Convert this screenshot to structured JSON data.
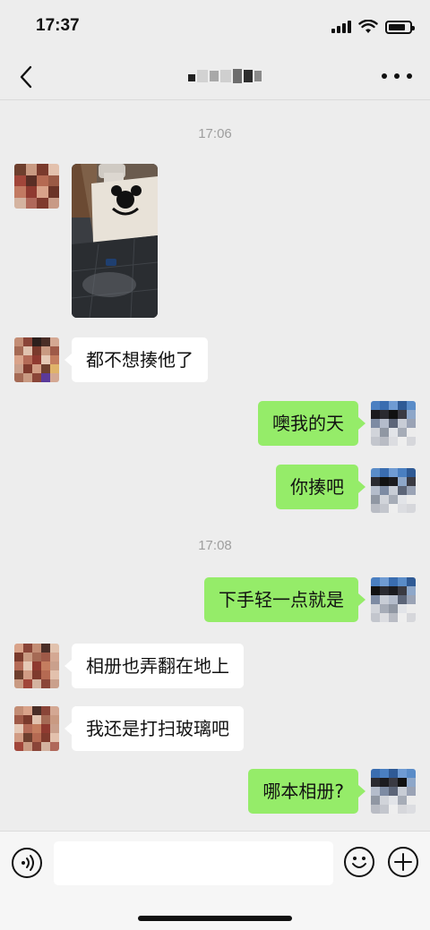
{
  "status_bar": {
    "time": "17:37",
    "battery_level": 0.8
  },
  "nav": {
    "back_icon": "chevron-left-icon",
    "title": "",
    "more_icon": "ellipsis-icon"
  },
  "messages": [
    {
      "type": "timestamp",
      "text": "17:06"
    },
    {
      "type": "image",
      "side": "left"
    },
    {
      "type": "text",
      "side": "left",
      "text": "都不想揍他了"
    },
    {
      "type": "text",
      "side": "right",
      "text": "噢我的天"
    },
    {
      "type": "text",
      "side": "right",
      "text": "你揍吧"
    },
    {
      "type": "timestamp",
      "text": "17:08"
    },
    {
      "type": "text",
      "side": "right",
      "text": "下手轻一点就是"
    },
    {
      "type": "text",
      "side": "left",
      "text": "相册也弄翻在地上"
    },
    {
      "type": "text",
      "side": "left",
      "text": "我还是打扫玻璃吧"
    },
    {
      "type": "text",
      "side": "right",
      "text": "哪本相册?"
    }
  ],
  "input_bar": {
    "voice_icon": "voice-icon",
    "input_value": "",
    "emoji_icon": "emoji-icon",
    "plus_icon": "plus-icon"
  },
  "colors": {
    "background": "#ededed",
    "sent_bubble": "#95ec69",
    "received_bubble": "#ffffff"
  }
}
